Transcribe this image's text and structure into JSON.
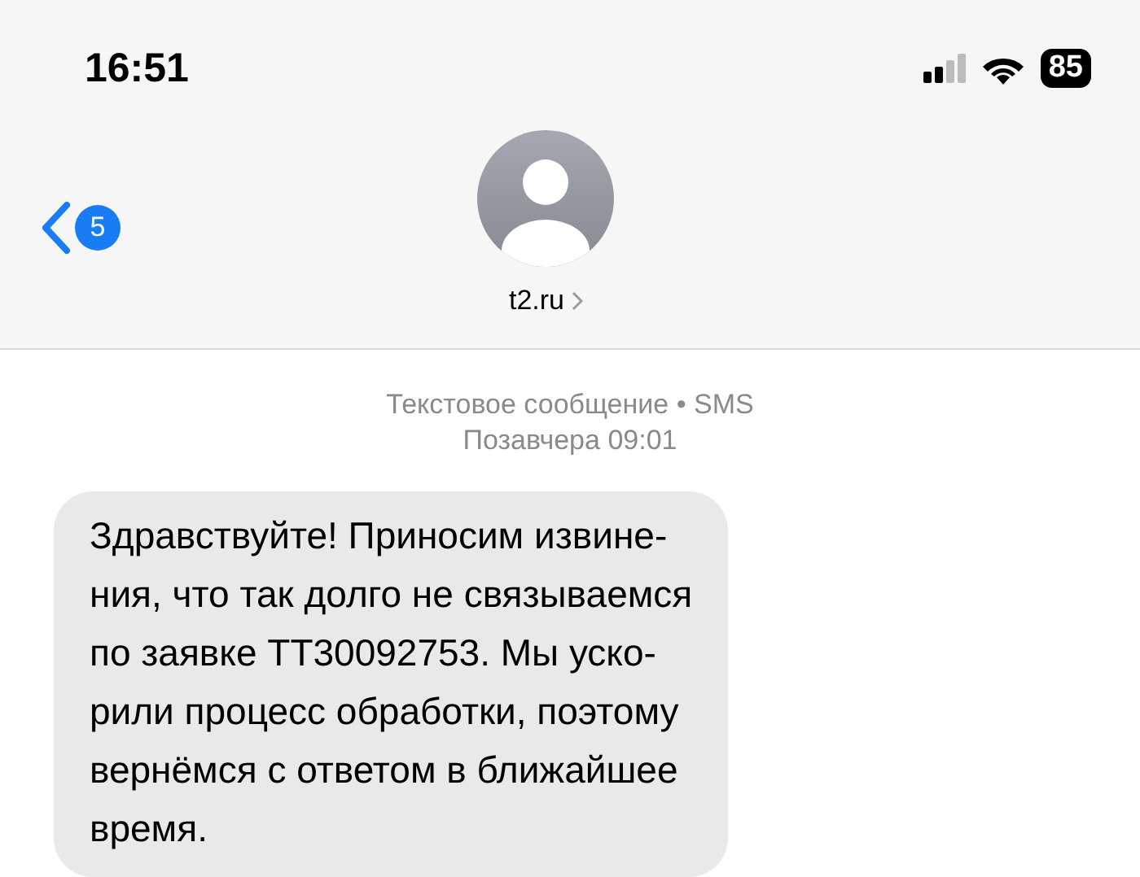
{
  "status_bar": {
    "time": "16:51",
    "battery": "85"
  },
  "header": {
    "unread_count": "5",
    "contact": "t2.ru"
  },
  "meta": {
    "type": "Текстовое сообщение • SMS",
    "date": "Позавчера 09:01"
  },
  "messages": [
    {
      "kind": "incoming",
      "text": "Здравствуйте! Приносим извине-\nния, что так долго не связываемся\nпо заявке ТТ30092753. Мы уско-\nрили процесс обработки, поэтому\nвернёмся с ответом в ближайшее\nвремя."
    }
  ]
}
